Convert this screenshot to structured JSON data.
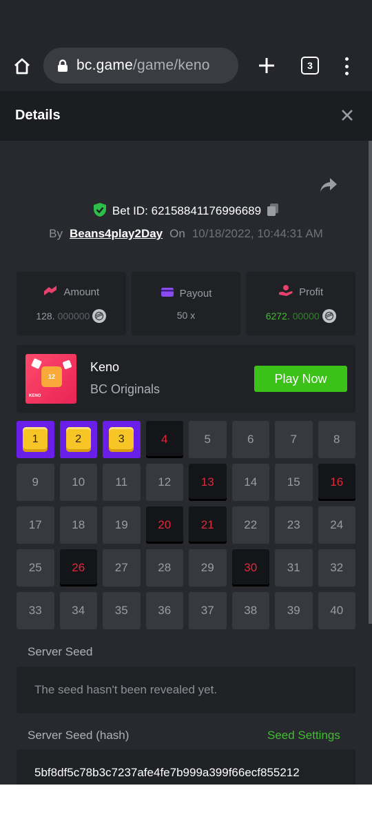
{
  "browser": {
    "url_host": "bc.game",
    "url_path": "/game/keno",
    "tab_count": "3",
    "icons": {
      "home": "home-icon",
      "lock": "lock-icon",
      "new_tab": "plus-icon",
      "tabs": "tabs-icon",
      "menu": "more-vert-icon"
    }
  },
  "header": {
    "title": "Details",
    "close_icon": "close-icon"
  },
  "bet": {
    "share_icon": "share-icon",
    "bet_id_label": "Bet ID: 62158841176996689",
    "by_label": "By",
    "username": "Beans4play2Day",
    "on_label": "On",
    "datetime": "10/18/2022, 10:44:31 AM"
  },
  "stats": {
    "amount": {
      "label": "Amount",
      "value_main": "128.",
      "value_dim": "000000"
    },
    "payout": {
      "label": "Payout",
      "value": "50 x"
    },
    "profit": {
      "label": "Profit",
      "value_main": "6272.",
      "value_dim": "00000"
    }
  },
  "game": {
    "name": "Keno",
    "provider": "BC Originals",
    "play_label": "Play Now",
    "thumb_number": "12",
    "thumb_logo": "KENO"
  },
  "keno": {
    "numbers": [
      "1",
      "2",
      "3",
      "4",
      "5",
      "6",
      "7",
      "8",
      "9",
      "10",
      "11",
      "12",
      "13",
      "14",
      "15",
      "16",
      "17",
      "18",
      "19",
      "20",
      "21",
      "22",
      "23",
      "24",
      "25",
      "26",
      "27",
      "28",
      "29",
      "30",
      "31",
      "32",
      "33",
      "34",
      "35",
      "36",
      "37",
      "38",
      "39",
      "40"
    ],
    "hits": [
      "1",
      "2",
      "3"
    ],
    "misses": [
      "4",
      "13",
      "16",
      "20",
      "21",
      "26",
      "30"
    ]
  },
  "seeds": {
    "server_seed_label": "Server Seed",
    "server_seed_value": "The seed hasn't been revealed yet.",
    "server_hash_label": "Server Seed (hash)",
    "seed_settings_label": "Seed Settings",
    "server_hash_value": "5bf8df5c78b3c7237afe4fe7b999a399f66ecf855212"
  },
  "colors": {
    "accent_green": "#3bc117",
    "hit_purple": "#6a1fe8",
    "miss_red": "#e2283a",
    "panel": "#1f2125"
  }
}
